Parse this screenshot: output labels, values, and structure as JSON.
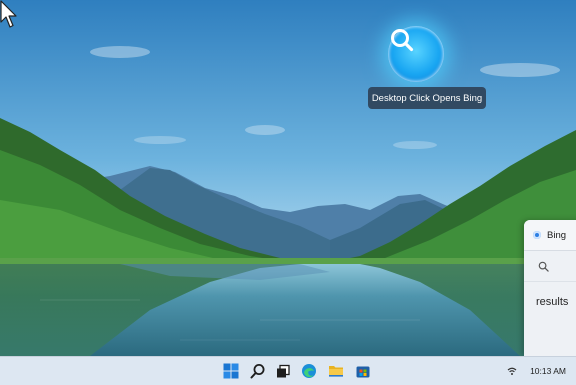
{
  "desktop": {
    "tooltip": "Desktop Click Opens Bing"
  },
  "bing_panel": {
    "title": "Bing",
    "results_label": "results"
  },
  "taskbar": {
    "time": "10:13 AM",
    "icons": [
      "windows-start-icon",
      "search-icon",
      "task-view-icon",
      "edge-icon",
      "file-explorer-icon",
      "store-icon"
    ]
  },
  "colors": {
    "orb": "#1aa6f2",
    "taskbar": "#e2e9f2",
    "accent": "#2d7fe3"
  }
}
